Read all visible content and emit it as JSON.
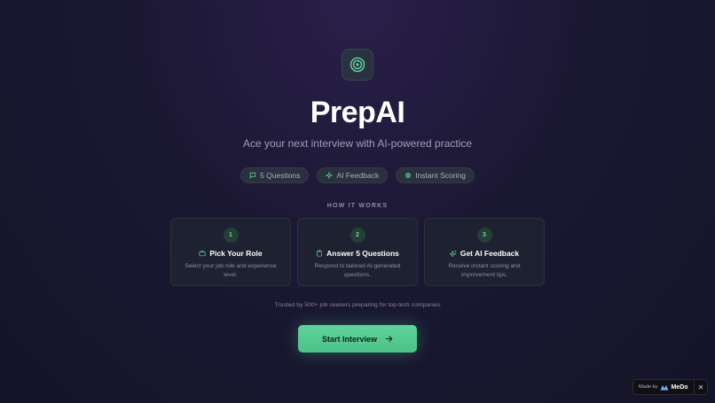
{
  "app": {
    "title": "PrepAI",
    "subtitle": "Ace your next interview with AI-powered practice"
  },
  "logo": {
    "icon": "target-icon",
    "color": "#5fd39a"
  },
  "features": [
    {
      "icon": "chat-icon",
      "label": "5 Questions"
    },
    {
      "icon": "sparkle-icon",
      "label": "AI Feedback"
    },
    {
      "icon": "dot-icon",
      "label": "Instant Scoring"
    }
  ],
  "how_it_works": {
    "heading": "HOW IT WORKS",
    "steps": [
      {
        "number": "1",
        "icon": "briefcase-icon",
        "title": "Pick Your Role",
        "description": "Select your job role and experience level."
      },
      {
        "number": "2",
        "icon": "clipboard-icon",
        "title": "Answer 5 Questions",
        "description": "Respond to tailored AI-generated questions."
      },
      {
        "number": "3",
        "icon": "sparkle-icon",
        "title": "Get AI Feedback",
        "description": "Receive instant scoring and improvement tips."
      }
    ]
  },
  "trusted_text": "Trusted by 500+ job seekers preparing for top tech companies",
  "cta": {
    "label": "Start Interview",
    "icon": "arrow-right-icon"
  },
  "badge": {
    "made_by": "Made by",
    "brand": "MeDo",
    "close": "✕"
  },
  "colors": {
    "accent": "#5fd39a",
    "background": "#1b1833",
    "card": "#1e2130"
  }
}
